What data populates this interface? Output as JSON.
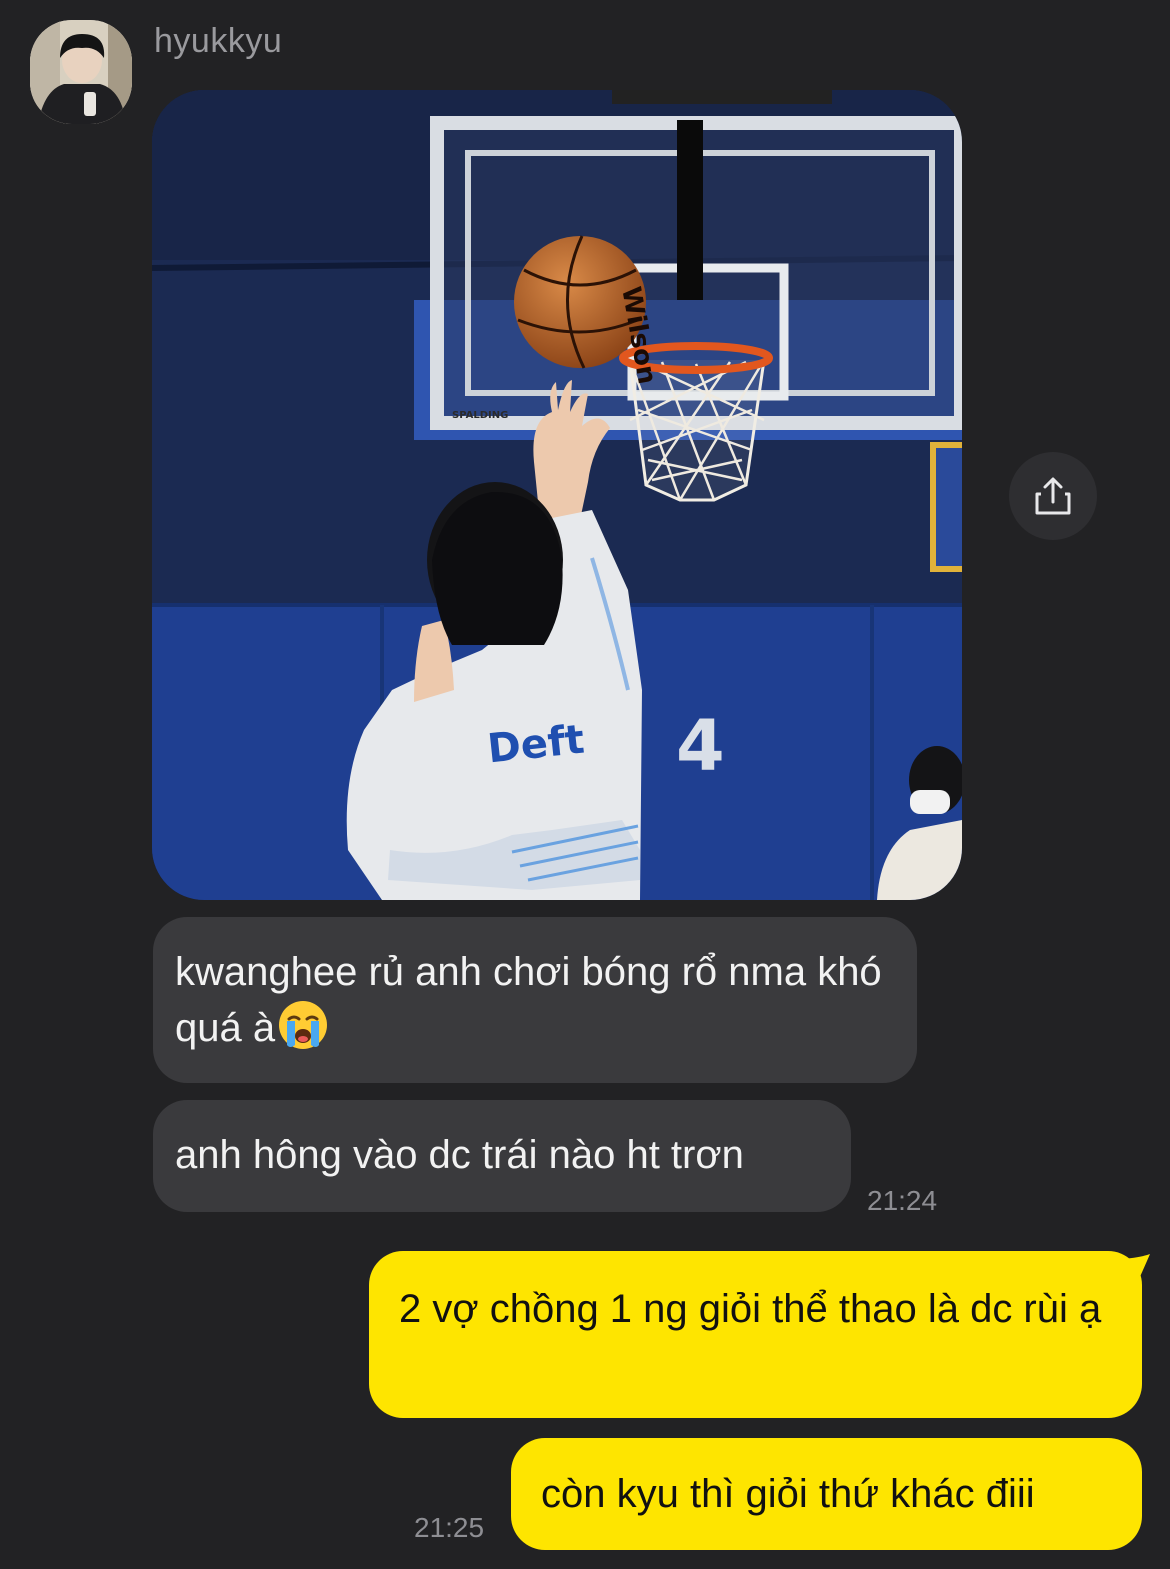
{
  "sender": {
    "name": "hyukkyu"
  },
  "image_message": {
    "jersey_text": "Deft",
    "jersey_number": "4",
    "backboard_brand": "SPALDING",
    "ball_brand": "Wilson"
  },
  "incoming_messages": [
    {
      "text": "kwanghee rủ anh chơi bóng rổ nma khó quá à",
      "emoji": "loudly-crying-face"
    },
    {
      "text": "anh hông vào dc trái nào ht trơn"
    }
  ],
  "incoming_time": "21:24",
  "outgoing_messages": [
    {
      "text": "2 vợ chồng 1 ng giỏi thể thao là dc rùi ạ"
    },
    {
      "text": "còn kyu thì giỏi thứ khác điii"
    }
  ],
  "outgoing_time": "21:25",
  "colors": {
    "background": "#222224",
    "incoming_bubble": "#3a3a3d",
    "outgoing_bubble": "#fee500",
    "timestamp": "#8e8e93"
  },
  "icons": {
    "share": "share-icon"
  }
}
